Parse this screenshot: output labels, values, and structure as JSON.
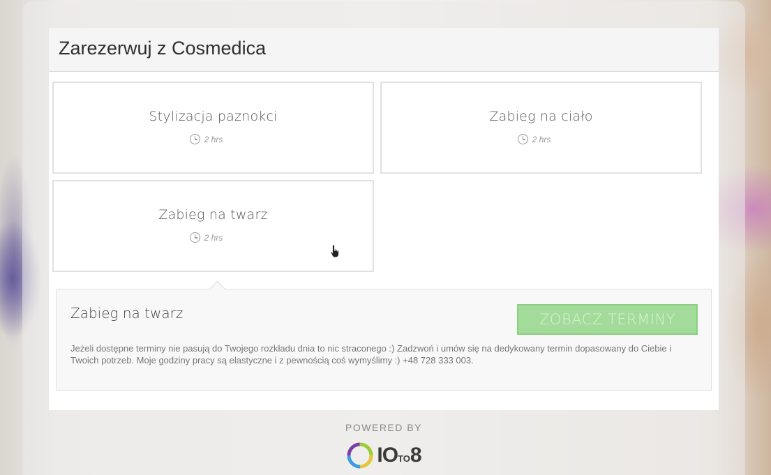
{
  "header": {
    "title": "Zarezerwuj z Cosmedica"
  },
  "services": [
    {
      "name": "Stylizacja paznokci",
      "duration": "2 hrs"
    },
    {
      "name": "Zabieg na ciało",
      "duration": "2 hrs"
    },
    {
      "name": "Zabieg na twarz",
      "duration": "2 hrs"
    }
  ],
  "detail": {
    "title": "Zabieg na twarz",
    "button_label": "ZOBACZ TERMINY",
    "description": "Jeżeli dostępne terminy nie pasują do Twojego rozkładu dnia to nic straconego :) Zadzwoń i umów się na dedykowany termin dopasowany do Ciebie i Twoich potrzeb. Moje godziny pracy są elastyczne i z pewnością coś wymyślimy :) +48 728 333 003."
  },
  "footer": {
    "powered_by": "POWERED BY",
    "logo_main": "IO",
    "logo_to": "TO",
    "logo_end": "8"
  },
  "colors": {
    "button_bg": "#a3dc9a",
    "button_text": "#d9f2d4",
    "logo_ring": [
      "#e8c63a",
      "#3d9be0",
      "#7b3ea8",
      "#9acd32"
    ]
  },
  "icons": [
    "clock-icon",
    "hand-cursor-icon",
    "ten-to-eight-logo-icon"
  ]
}
